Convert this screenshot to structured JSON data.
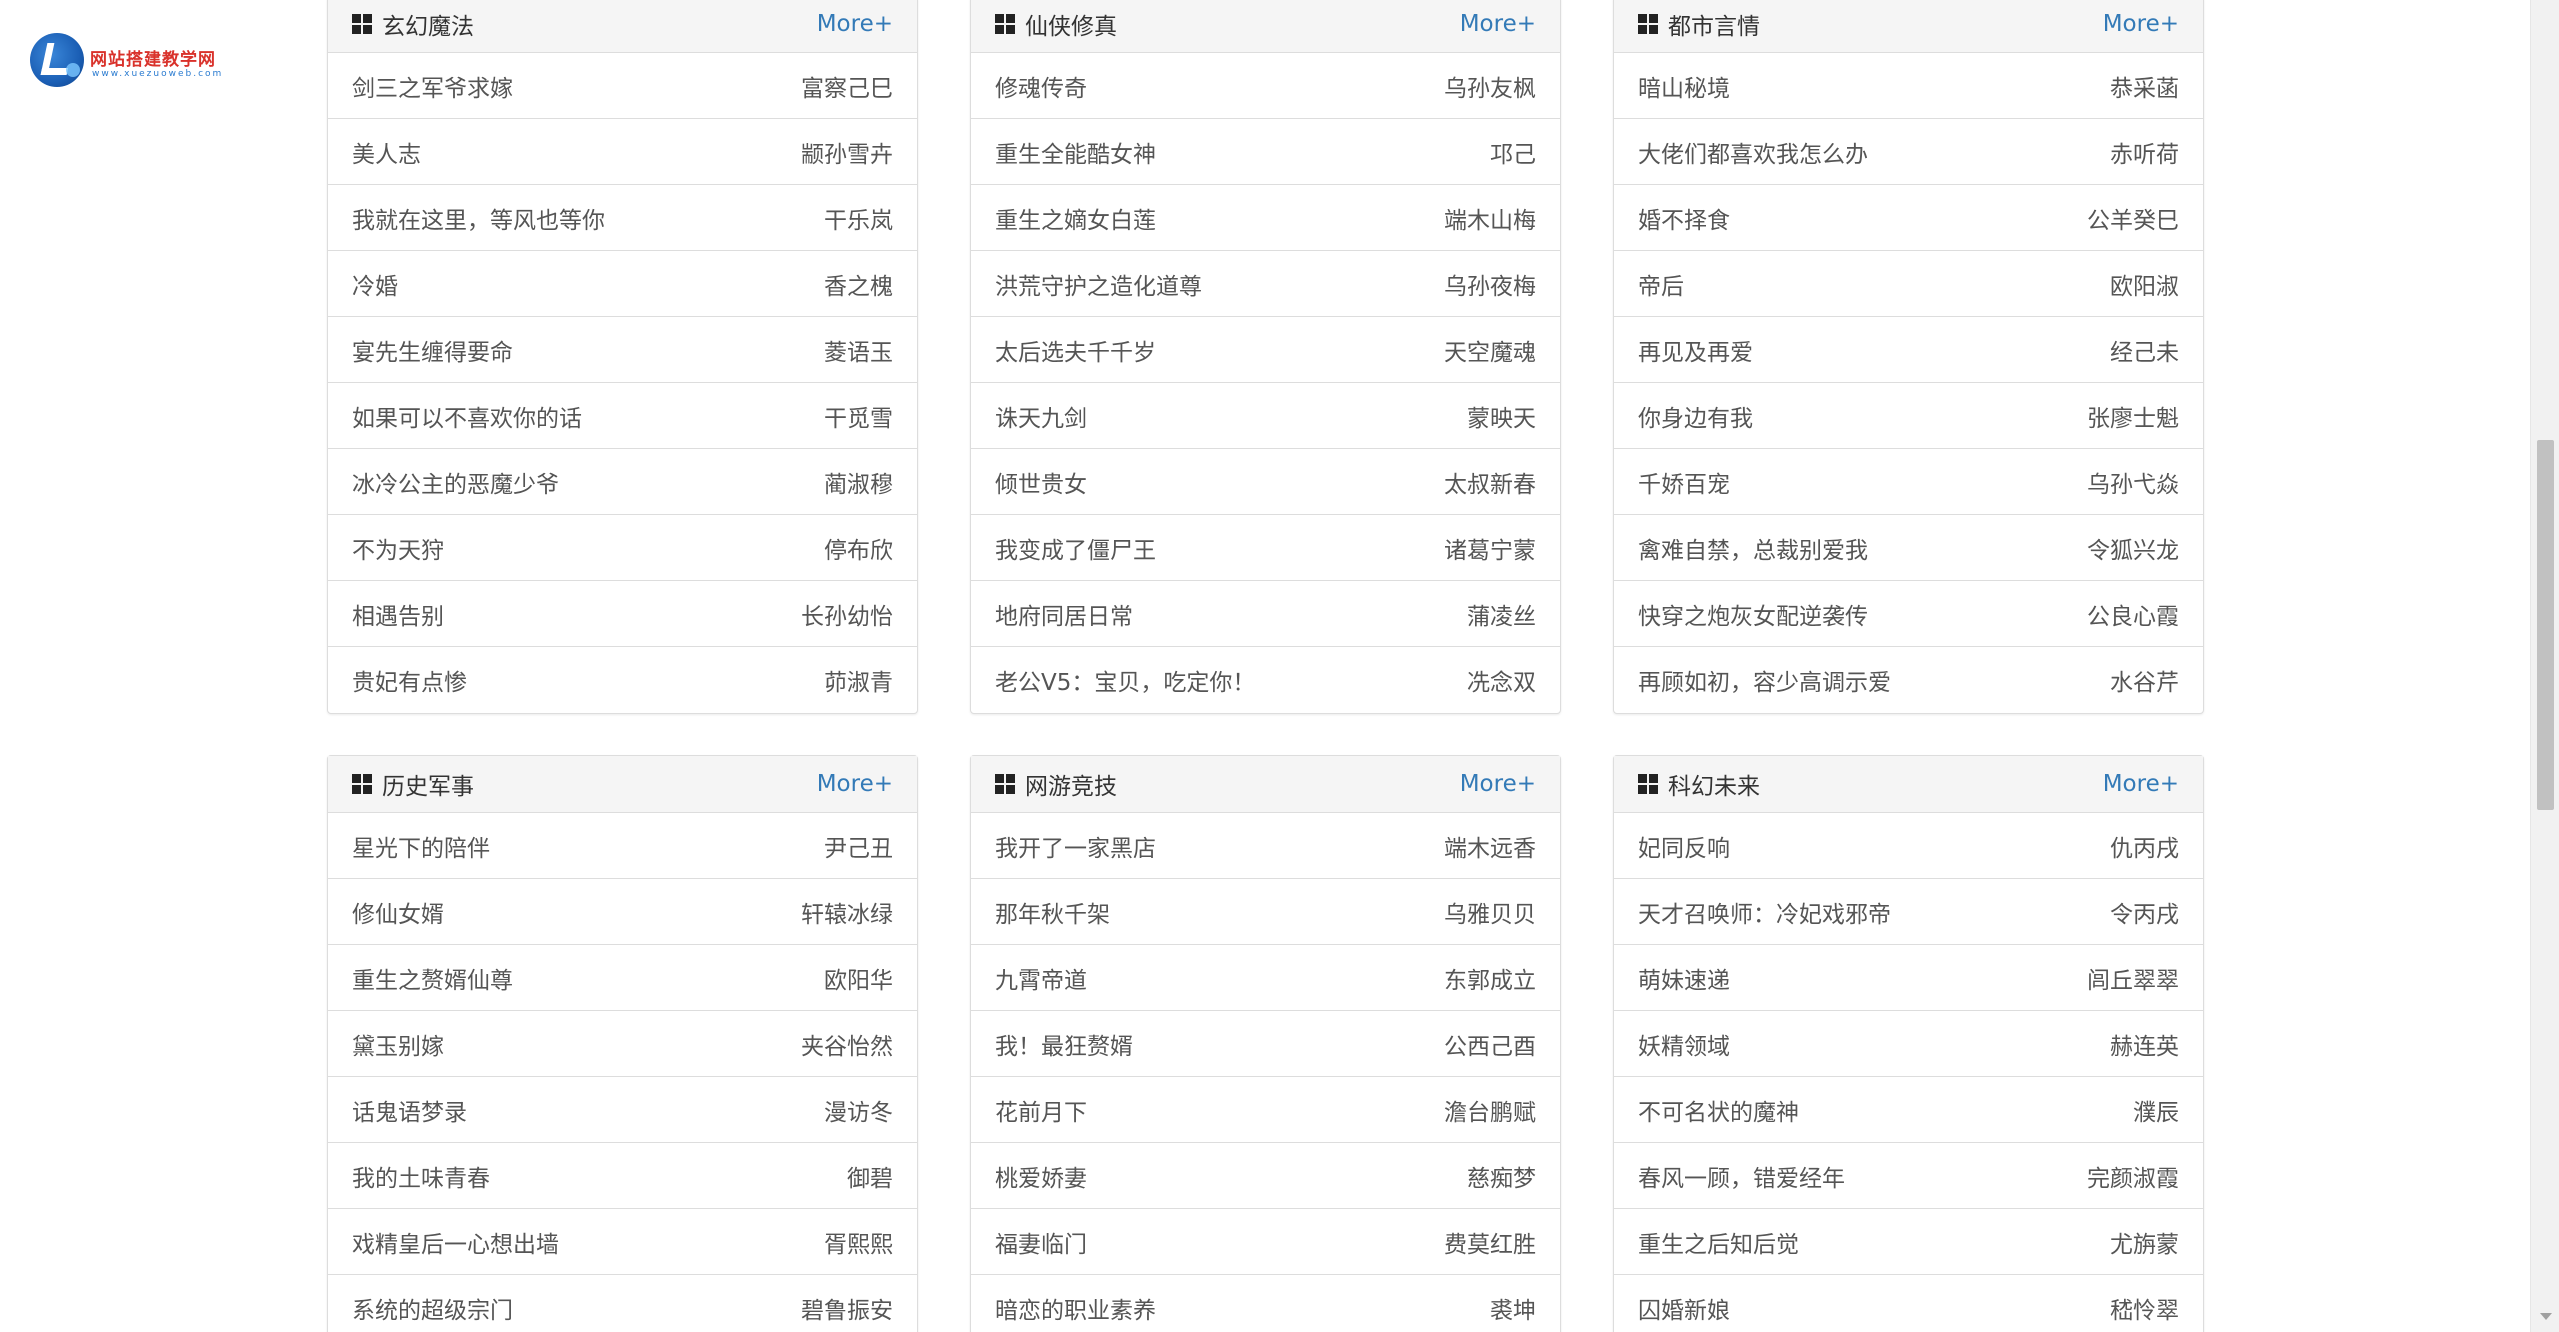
{
  "logo": {
    "title": "网站搭建教学网",
    "subtitle": "www.xuezuoweb.com"
  },
  "more_label": "More+",
  "panels": [
    {
      "title": "玄幻魔法",
      "items": [
        {
          "title": "剑三之军爷求嫁",
          "author": "富察己巳"
        },
        {
          "title": "美人志",
          "author": "颛孙雪卉"
        },
        {
          "title": "我就在这里，等风也等你",
          "author": "干乐岚"
        },
        {
          "title": "冷婚",
          "author": "香之槐"
        },
        {
          "title": "宴先生缠得要命",
          "author": "菱语玉"
        },
        {
          "title": "如果可以不喜欢你的话",
          "author": "干觅雪"
        },
        {
          "title": "冰冷公主的恶魔少爷",
          "author": "蔺淑穆"
        },
        {
          "title": "不为天狩",
          "author": "停布欣"
        },
        {
          "title": "相遇告别",
          "author": "长孙幼怡"
        },
        {
          "title": "贵妃有点惨",
          "author": "茆淑青"
        }
      ]
    },
    {
      "title": "仙侠修真",
      "items": [
        {
          "title": "修魂传奇",
          "author": "乌孙友枫"
        },
        {
          "title": "重生全能酷女神",
          "author": "邛己"
        },
        {
          "title": "重生之嫡女白莲",
          "author": "端木山梅"
        },
        {
          "title": "洪荒守护之造化道尊",
          "author": "乌孙夜梅"
        },
        {
          "title": "太后选夫千千岁",
          "author": "天空魔魂"
        },
        {
          "title": "诛天九剑",
          "author": "蒙映天"
        },
        {
          "title": "倾世贵女",
          "author": "太叔新春"
        },
        {
          "title": "我变成了僵尸王",
          "author": "诸葛宁蒙"
        },
        {
          "title": "地府同居日常",
          "author": "蒲凌丝"
        },
        {
          "title": "老公V5：宝贝，吃定你！",
          "author": "冼念双"
        }
      ]
    },
    {
      "title": "都市言情",
      "items": [
        {
          "title": "暗山秘境",
          "author": "恭采菡"
        },
        {
          "title": "大佬们都喜欢我怎么办",
          "author": "赤听荷"
        },
        {
          "title": "婚不择食",
          "author": "公羊癸巳"
        },
        {
          "title": "帝后",
          "author": "欧阳淑"
        },
        {
          "title": "再见及再爱",
          "author": "经己未"
        },
        {
          "title": "你身边有我",
          "author": "张廖士魁"
        },
        {
          "title": "千娇百宠",
          "author": "乌孙弋焱"
        },
        {
          "title": "禽难自禁，总裁别爱我",
          "author": "令狐兴龙"
        },
        {
          "title": "快穿之炮灰女配逆袭传",
          "author": "公良心霞"
        },
        {
          "title": "再顾如初，容少高调示爱",
          "author": "水谷芹"
        }
      ]
    },
    {
      "title": "历史军事",
      "items": [
        {
          "title": "星光下的陪伴",
          "author": "尹己丑"
        },
        {
          "title": "修仙女婿",
          "author": "轩辕冰绿"
        },
        {
          "title": "重生之赘婿仙尊",
          "author": "欧阳华"
        },
        {
          "title": "黛玉别嫁",
          "author": "夹谷怡然"
        },
        {
          "title": "话鬼语梦录",
          "author": "漫访冬"
        },
        {
          "title": "我的土味青春",
          "author": "御碧"
        },
        {
          "title": "戏精皇后一心想出墙",
          "author": "胥熙熙"
        },
        {
          "title": "系统的超级宗门",
          "author": "碧鲁振安"
        }
      ]
    },
    {
      "title": "网游竞技",
      "items": [
        {
          "title": "我开了一家黑店",
          "author": "端木远香"
        },
        {
          "title": "那年秋千架",
          "author": "乌雅贝贝"
        },
        {
          "title": "九霄帝道",
          "author": "东郭成立"
        },
        {
          "title": "我！最狂赘婿",
          "author": "公西己酉"
        },
        {
          "title": "花前月下",
          "author": "澹台鹏赋"
        },
        {
          "title": "桃爱娇妻",
          "author": "慈痴梦"
        },
        {
          "title": "福妻临门",
          "author": "费莫红胜"
        },
        {
          "title": "暗恋的职业素养",
          "author": "裘坤"
        }
      ]
    },
    {
      "title": "科幻未来",
      "items": [
        {
          "title": "妃同反响",
          "author": "仇丙戌"
        },
        {
          "title": "天才召唤师：冷妃戏邪帝",
          "author": "令丙戌"
        },
        {
          "title": "萌妹速递",
          "author": "闾丘翠翠"
        },
        {
          "title": "妖精领域",
          "author": "赫连英"
        },
        {
          "title": "不可名状的魔神",
          "author": "濮辰"
        },
        {
          "title": "春风一顾，错爱经年",
          "author": "完颜淑霞"
        },
        {
          "title": "重生之后知后觉",
          "author": "尤旃蒙"
        },
        {
          "title": "囚婚新娘",
          "author": "嵇怜翠"
        }
      ]
    }
  ]
}
